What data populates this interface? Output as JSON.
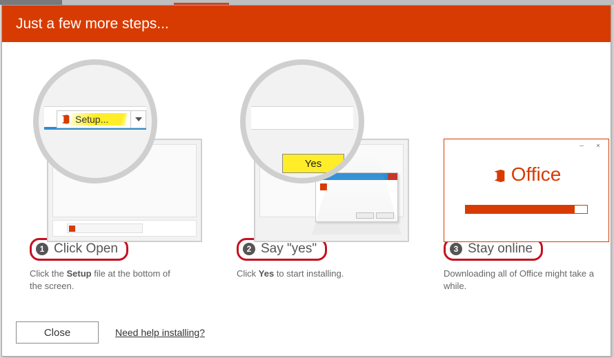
{
  "header": {
    "title": "Just a few more steps..."
  },
  "steps": [
    {
      "badge": "1",
      "title": "Click Open",
      "desc_pre": "Click the ",
      "desc_bold": "Setup",
      "desc_post": " file at the bottom of the screen.",
      "magnifier_label": "Setup..."
    },
    {
      "badge": "2",
      "title": "Say \"yes\"",
      "desc_pre": "Click ",
      "desc_bold": "Yes",
      "desc_post": " to start installing.",
      "magnifier_label": "Yes"
    },
    {
      "badge": "3",
      "title": "Stay online",
      "desc_pre": "Downloading all of Office might take a while.",
      "desc_bold": "",
      "desc_post": "",
      "brand": "Office",
      "window_controls": "– ×",
      "progress_pct": 90
    }
  ],
  "footer": {
    "close_label": "Close",
    "help_label": "Need help installing?"
  },
  "colors": {
    "accent": "#d83b01",
    "highlight": "#ffed29",
    "ring_red": "#c50f1f"
  }
}
